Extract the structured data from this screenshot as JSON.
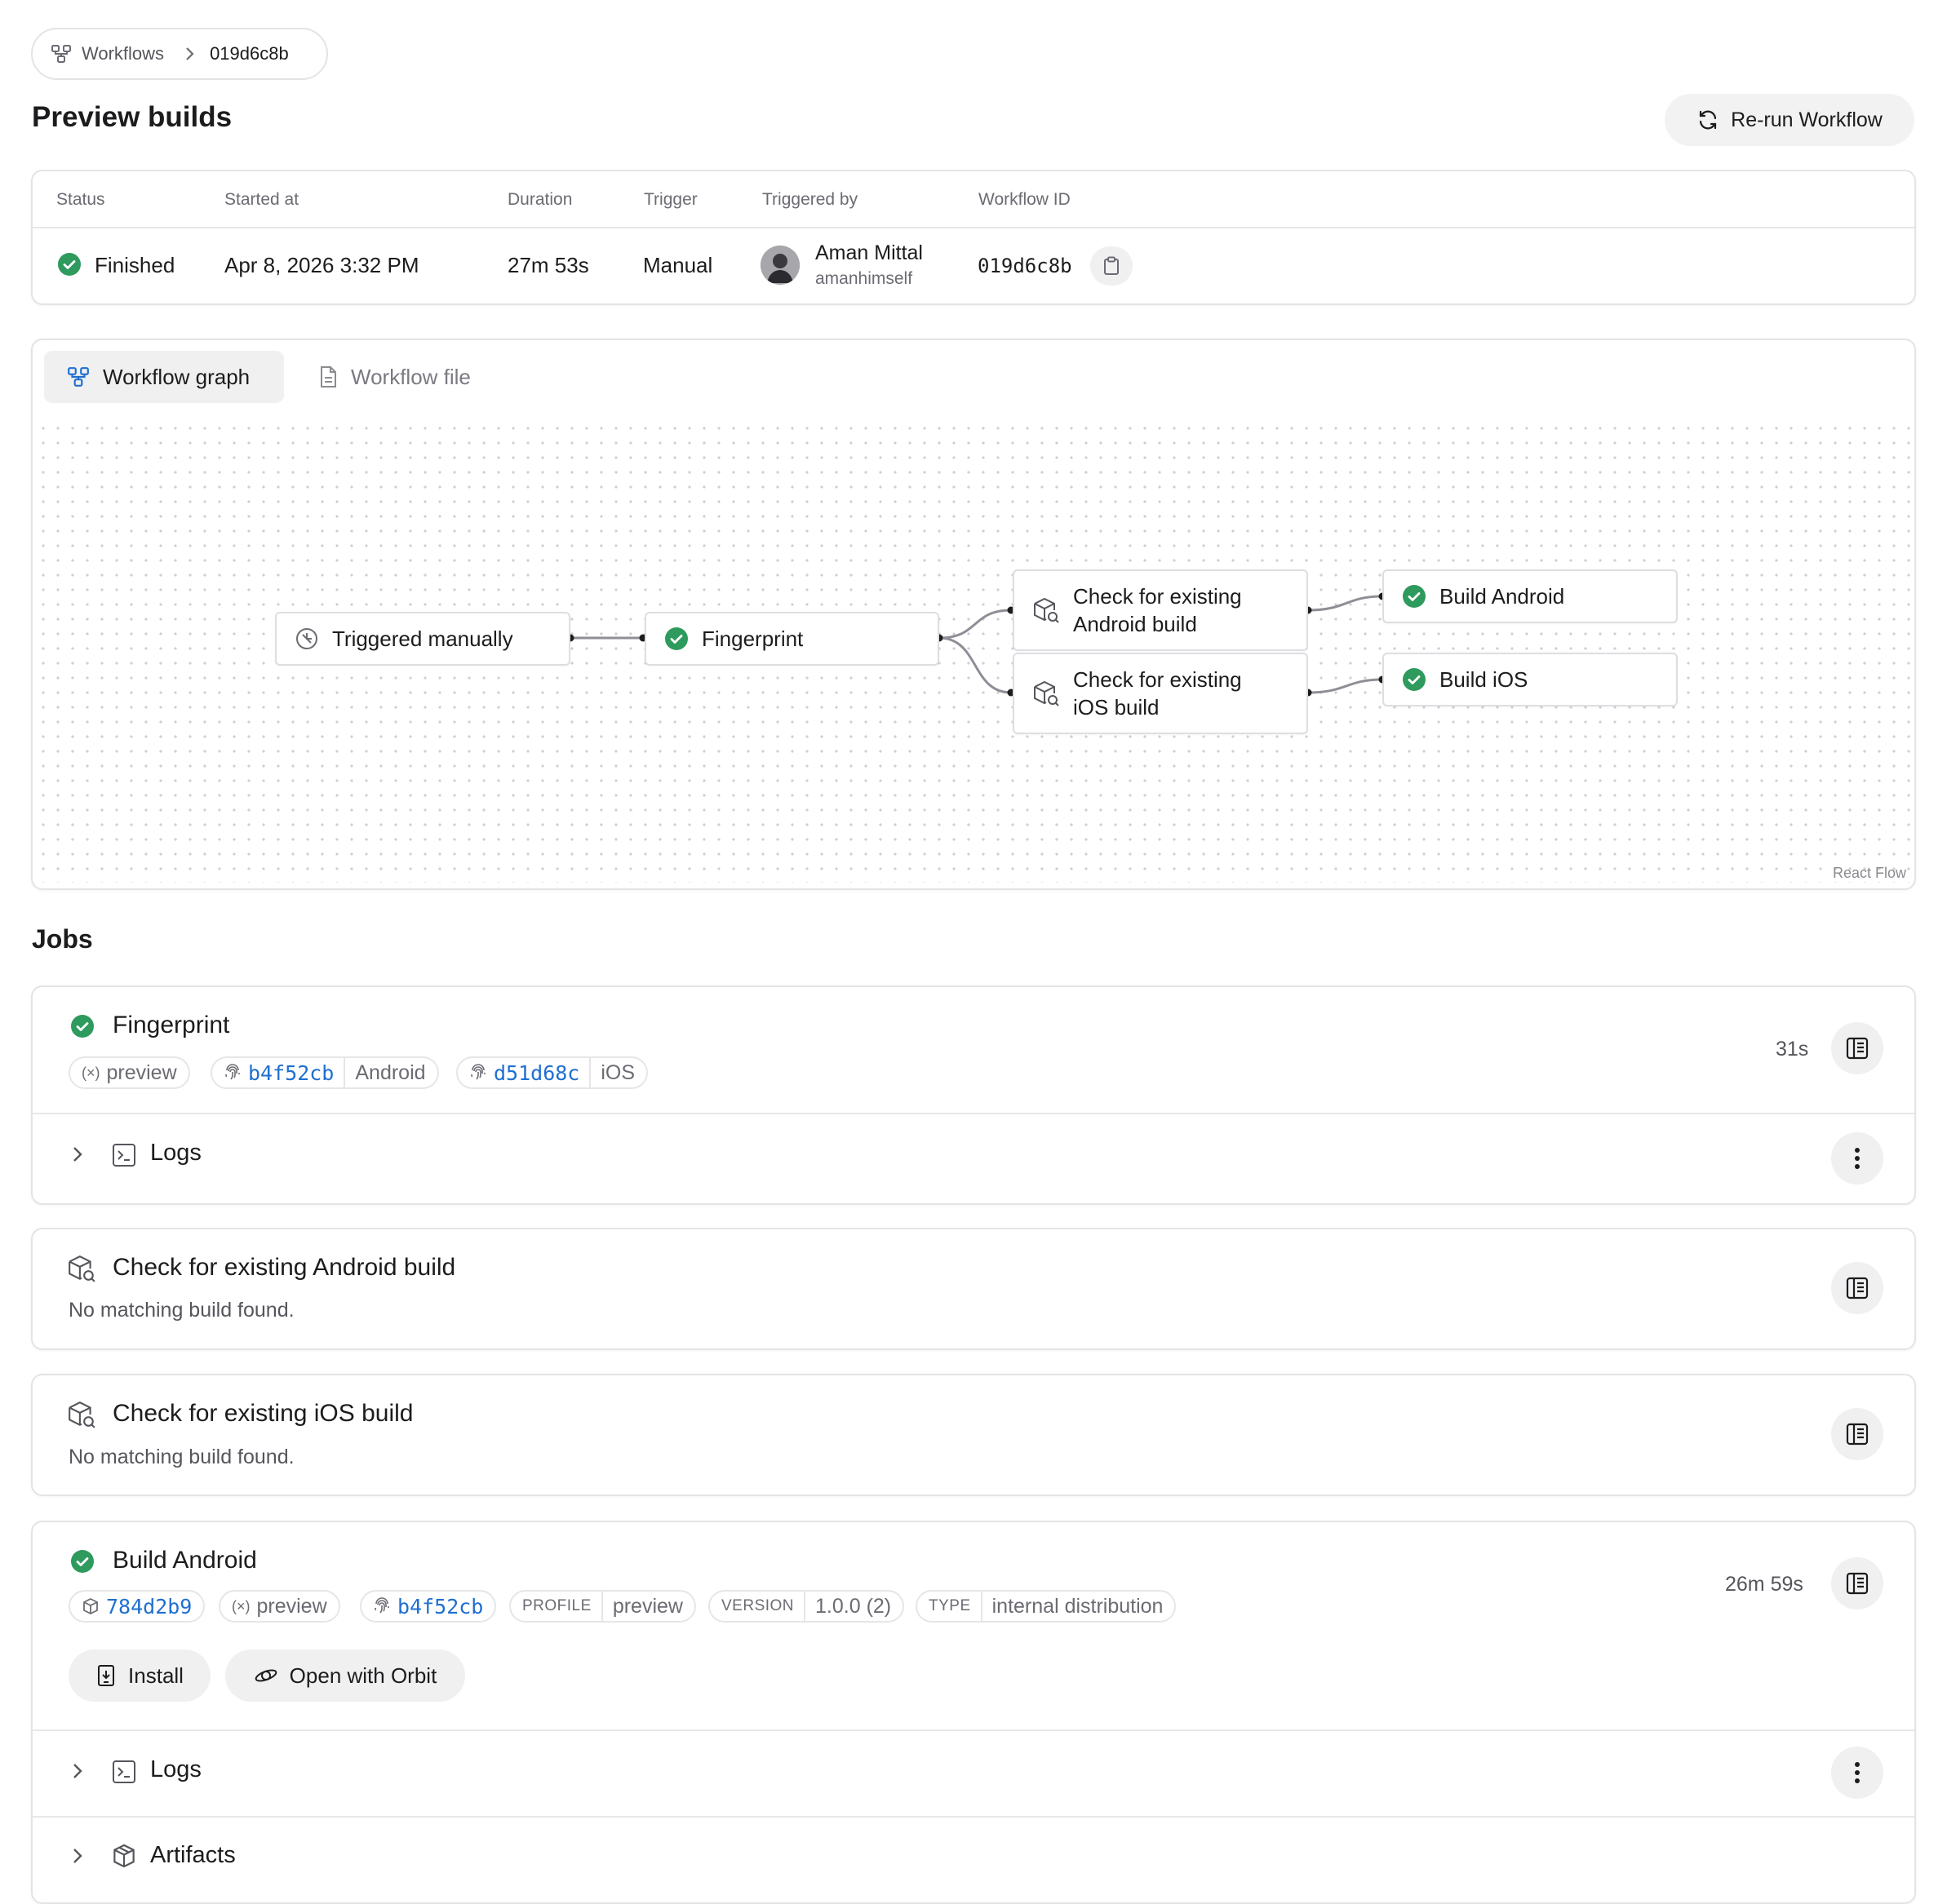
{
  "breadcrumb": {
    "parent": "Workflows",
    "current": "019d6c8b"
  },
  "page_title": "Preview builds",
  "rerun_label": "Re-run Workflow",
  "summary": {
    "headers": {
      "status": "Status",
      "started": "Started at",
      "duration": "Duration",
      "trigger": "Trigger",
      "triggered_by": "Triggered by",
      "workflow_id": "Workflow ID"
    },
    "status": "Finished",
    "started": "Apr 8, 2026 3:32 PM",
    "duration": "27m 53s",
    "trigger": "Manual",
    "user_name": "Aman Mittal",
    "user_handle": "amanhimself",
    "workflow_id": "019d6c8b"
  },
  "tabs": {
    "graph": "Workflow graph",
    "file": "Workflow file"
  },
  "graph": {
    "nodes": {
      "trigger": "Triggered manually",
      "fingerprint": "Fingerprint",
      "check_android_1": "Check for existing",
      "check_android_2": "Android build",
      "check_ios_1": "Check for existing",
      "check_ios_2": "iOS build",
      "build_android": "Build Android",
      "build_ios": "Build iOS"
    },
    "credit": "React Flow"
  },
  "jobs_title": "Jobs",
  "jobs": {
    "fingerprint": {
      "title": "Fingerprint",
      "duration": "31s",
      "env": "preview",
      "android_hash": "b4f52cb",
      "android_label": "Android",
      "ios_hash": "d51d68c",
      "ios_label": "iOS",
      "logs": "Logs"
    },
    "check_android": {
      "title": "Check for existing Android build",
      "message": "No matching build found."
    },
    "check_ios": {
      "title": "Check for existing iOS build",
      "message": "No matching build found."
    },
    "build_android": {
      "title": "Build Android",
      "duration": "26m 59s",
      "build_hash": "784d2b9",
      "env": "preview",
      "fingerprint_hash": "b4f52cb",
      "profile_key": "PROFILE",
      "profile_val": "preview",
      "version_key": "VERSION",
      "version_val": "1.0.0 (2)",
      "type_key": "TYPE",
      "type_val": "internal distribution",
      "install": "Install",
      "orbit": "Open with Orbit",
      "logs": "Logs",
      "artifacts": "Artifacts"
    }
  },
  "colors": {
    "success": "#2e9a5e",
    "link": "#1f6fd1",
    "border": "#e4e4e7"
  }
}
